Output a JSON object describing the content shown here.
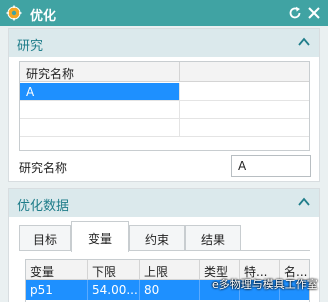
{
  "window": {
    "title": "优化",
    "icons": {
      "app": "gear-icon",
      "reset": "reset-icon",
      "close": "close-icon"
    }
  },
  "study_group": {
    "header": "研究",
    "list": {
      "column_header": "研究名称",
      "rows": [
        "A"
      ]
    },
    "name_field": {
      "label": "研究名称",
      "value": "A"
    }
  },
  "optimization_group": {
    "header": "优化数据",
    "tabs": [
      "目标",
      "变量",
      "约束",
      "结果"
    ],
    "active_tab": "变量",
    "table": {
      "columns": [
        "变量",
        "下限",
        "上限",
        "类型",
        "特...",
        "名..."
      ],
      "rows": [
        {
          "name": "p51",
          "lower": "54.00...",
          "upper": "80",
          "type": "",
          "special": "",
          "label": ""
        }
      ]
    }
  },
  "watermark": "e多物理与模具工作室",
  "colors": {
    "titlebar": "#40a3a3",
    "accent": "#1f7d8a",
    "selection": "#1e90ff",
    "group_header": "#dbe9ec"
  }
}
